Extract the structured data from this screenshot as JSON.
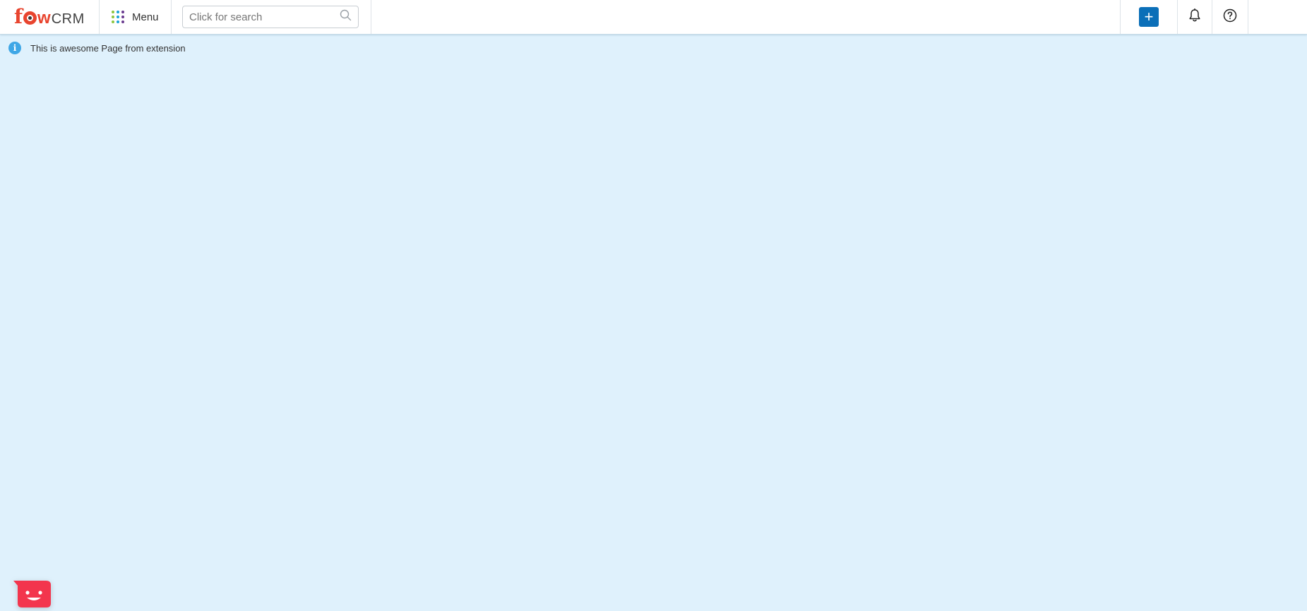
{
  "header": {
    "logo": {
      "brand_left": "f",
      "brand_mid": "w",
      "brand_right": "CRM",
      "alt": "fowCRM"
    },
    "menu_label": "Menu",
    "menu_dot_colors": [
      "#8dc63f",
      "#1ba3d8",
      "#6a3b8f",
      "#8dc63f",
      "#1ba3d8",
      "#6a3b8f",
      "#8dc63f",
      "#1ba3d8",
      "#6a3b8f"
    ],
    "search": {
      "placeholder": "Click for search",
      "value": "",
      "icon": "search-icon"
    },
    "actions": {
      "add_label": "+",
      "add_color": "#0b6fb8",
      "notifications_icon": "bell-icon",
      "help_icon": "help-circle-icon"
    }
  },
  "notice": {
    "icon": "info-icon",
    "icon_glyph": "i",
    "text": "This is awesome Page from extension"
  },
  "chat_widget": {
    "icon": "chat-smiley-icon",
    "color": "#f3354d"
  },
  "colors": {
    "background": "#dff1fc",
    "brand": "#e8442e"
  }
}
